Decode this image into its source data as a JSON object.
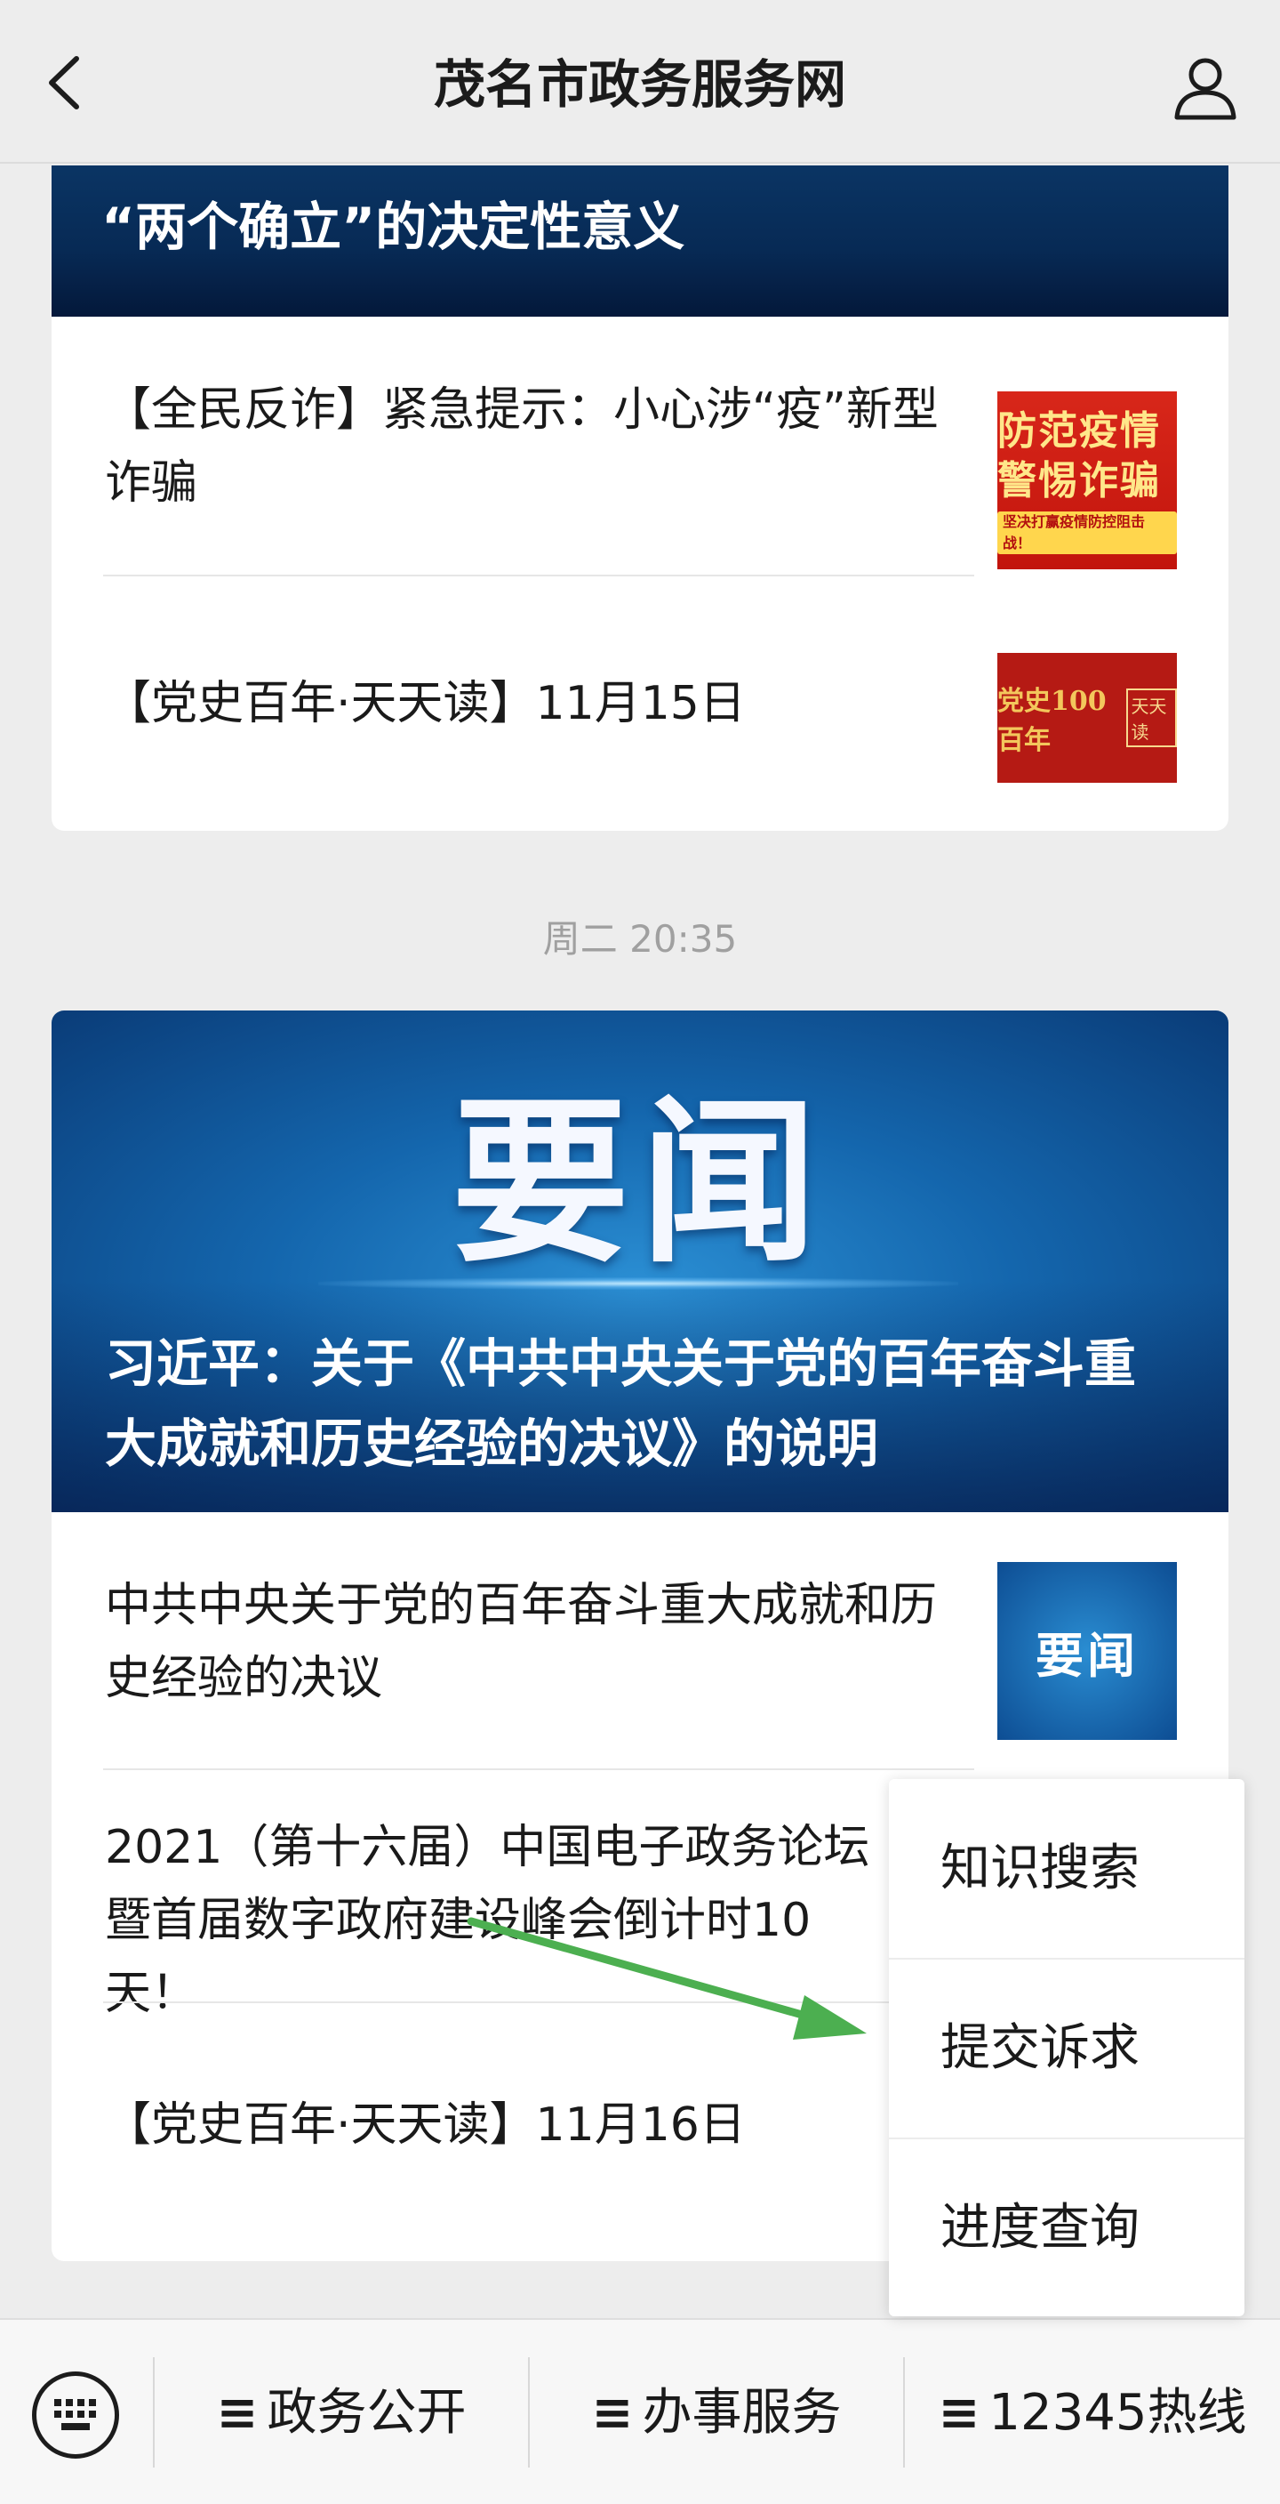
{
  "header": {
    "title": "茂名市政务服务网"
  },
  "card1": {
    "banner_title": "“两个确立”的决定性意义",
    "items": [
      {
        "text": "【全民反诈】紧急提示：小心涉“疫”新型诈骗",
        "thumb_text": "防范疫情 警惕诈骗",
        "thumb_subtext": "坚决打赢疫情防控阻击战！"
      },
      {
        "text": "【党史百年·天天读】11月15日",
        "thumb_text": "党史100百年",
        "thumb_subtext": "天天读"
      }
    ]
  },
  "timestamp": "周二 20:35",
  "card2": {
    "hero_big": "要闻",
    "hero_title": "习近平：关于《中共中央关于党的百年奋斗重大成就和历史经验的决议》的说明",
    "items": [
      {
        "text": "中共中央关于党的百年奋斗重大成就和历史经验的决议",
        "thumb_text": "要闻"
      },
      {
        "text": "2021（第十六届）中国电子政务论坛暨首届数字政府建设峰会倒计时10天！"
      },
      {
        "text": "【党史百年·天天读】11月16日"
      }
    ]
  },
  "popup_menu": {
    "items": [
      "知识搜索",
      "提交诉求",
      "进度查询"
    ]
  },
  "annotation": {
    "arrow_color": "#4caf50"
  },
  "bottom_menu": {
    "items": [
      "政务公开",
      "办事服务",
      "12345热线"
    ]
  }
}
